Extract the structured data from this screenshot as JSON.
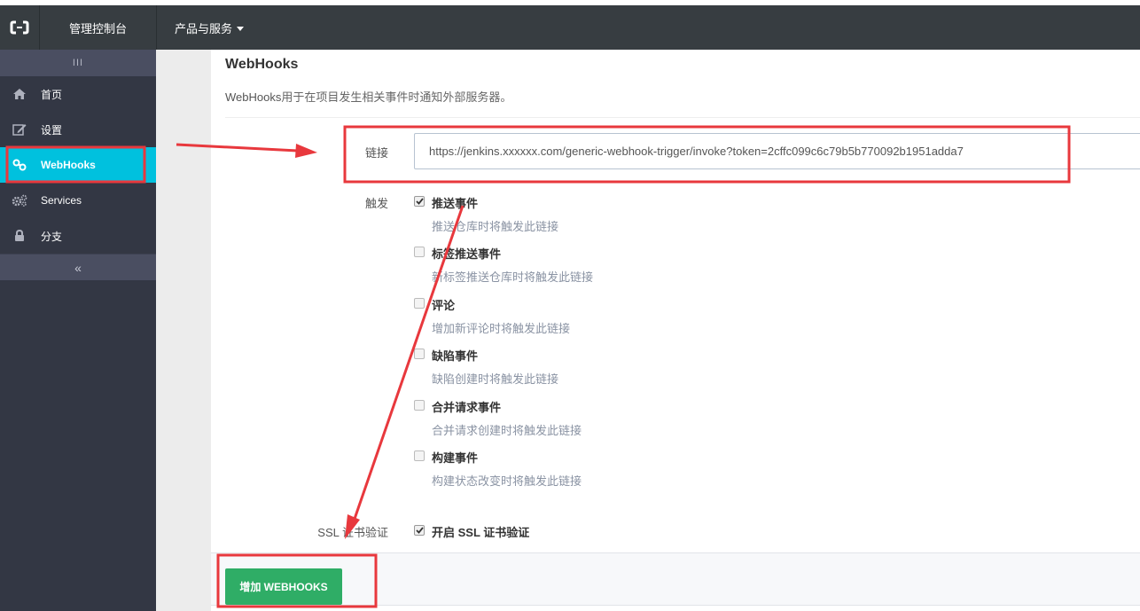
{
  "header": {
    "logo_icon": "aliyun-logo-icon",
    "console_label": "管理控制台",
    "products_label": "产品与服务"
  },
  "sidebar": {
    "toggle_label": "III",
    "collapse_label": "«",
    "items": [
      {
        "label": "首页",
        "icon": "home-icon",
        "active": false
      },
      {
        "label": "设置",
        "icon": "edit-icon",
        "active": false
      },
      {
        "label": "WebHooks",
        "icon": "link-icon",
        "active": true
      },
      {
        "label": "Services",
        "icon": "gears-icon",
        "active": false
      },
      {
        "label": "分支",
        "icon": "lock-icon",
        "active": false
      }
    ]
  },
  "main": {
    "title": "WebHooks",
    "description_prefix": "WebHooks",
    "description_rest": "用于在项目发生相关事件时通知外部服务器。",
    "url_label": "链接",
    "url_value": "https://jenkins.xxxxxx.com/generic-webhook-trigger/invoke?token=2cffc099c6c79b5b770092b1951adda7",
    "trigger_label": "触发",
    "triggers": [
      {
        "label": "推送事件",
        "desc": "推送仓库时将触发此链接",
        "checked": true
      },
      {
        "label": "标签推送事件",
        "desc": "新标签推送仓库时将触发此链接",
        "checked": false
      },
      {
        "label": "评论",
        "desc": "增加新评论时将触发此链接",
        "checked": false
      },
      {
        "label": "缺陷事件",
        "desc": "缺陷创建时将触发此链接",
        "checked": false
      },
      {
        "label": "合并请求事件",
        "desc": "合并请求创建时将触发此链接",
        "checked": false
      },
      {
        "label": "构建事件",
        "desc": "构建状态改变时将触发此链接",
        "checked": false
      }
    ],
    "ssl_label": "SSL 证书验证",
    "ssl_option": "开启 SSL 证书验证",
    "ssl_checked": true,
    "add_button": "增加 WEBHOOKS"
  },
  "colors": {
    "header_bg": "#373d41",
    "sidebar_bg": "#333744",
    "active_item": "#00c1de",
    "add_button": "#2fad66",
    "annotation_red": "#e8383d"
  }
}
